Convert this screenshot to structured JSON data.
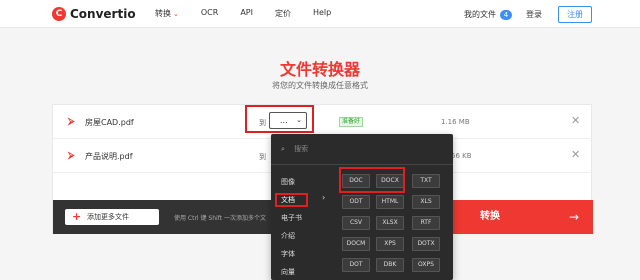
{
  "header": {
    "logo_mark": "C",
    "logo_text": "Convertio",
    "nav": [
      {
        "label": "转换",
        "has_chevron": true
      },
      {
        "label": "OCR"
      },
      {
        "label": "API"
      },
      {
        "label": "定价"
      },
      {
        "label": "Help"
      }
    ],
    "my_files": "我的文件",
    "my_files_count": "4",
    "login": "登录",
    "register": "注册"
  },
  "hero": {
    "title": "文件转换器",
    "subtitle": "将您的文件转换成任意格式"
  },
  "files": [
    {
      "name": "房屋CAD.pdf",
      "to": "到",
      "format": "...",
      "status": "准备好",
      "size": "1.16 MB"
    },
    {
      "name": "产品说明.pdf",
      "to": "到",
      "size": "56 KB"
    }
  ],
  "bottom": {
    "add_more": "添加更多文件",
    "hint": "使用 Ctrl 键 Shift 一次添加多个文",
    "convert": "转换",
    "convert_arrow": "→"
  },
  "dropdown": {
    "search_placeholder": "搜索",
    "categories": [
      "图像",
      "文档",
      "电子书",
      "介绍",
      "字体",
      "向量"
    ],
    "active_category": "文档",
    "formats": [
      [
        "DOC",
        "DOCX",
        "TXT"
      ],
      [
        "ODT",
        "HTML",
        "XLS"
      ],
      [
        "CSV",
        "XLSX",
        "RTF"
      ],
      [
        "DOCM",
        "XPS",
        "DOTX"
      ],
      [
        "DOT",
        "DBK",
        "OXPS"
      ]
    ]
  },
  "colors": {
    "brand": "#ee3831",
    "accent": "#3b8ff5",
    "highlight": "#e02020"
  }
}
